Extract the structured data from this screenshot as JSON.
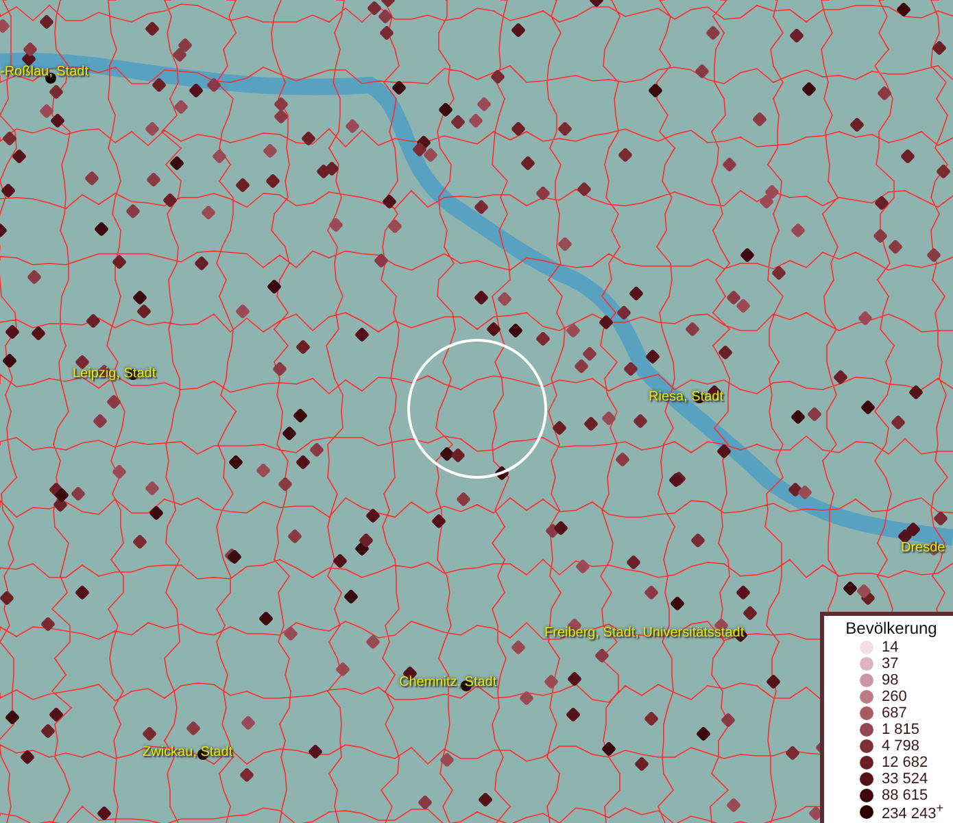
{
  "map": {
    "places": [
      {
        "name": "-Roßlau, Stadt"
      },
      {
        "name": "Leipzig, Stadt"
      },
      {
        "name": "Riesa, Stadt"
      },
      {
        "name": "Dresde"
      },
      {
        "name": "Freiberg, Stadt, Universitätsstadt"
      },
      {
        "name": "Chemnitz, Stadt"
      },
      {
        "name": "Zwickau, Stadt"
      }
    ]
  },
  "legend": {
    "title": "Bevölkerung",
    "entries": [
      {
        "label": "14",
        "color": "#f4dce8"
      },
      {
        "label": "37",
        "color": "#e0b4c2"
      },
      {
        "label": "98",
        "color": "#cd98a5"
      },
      {
        "label": "260",
        "color": "#bb7b86"
      },
      {
        "label": "687",
        "color": "#a85b64"
      },
      {
        "label": "1 815",
        "color": "#954550"
      },
      {
        "label": "4 798",
        "color": "#80323b"
      },
      {
        "label": "12 682",
        "color": "#6b2028"
      },
      {
        "label": "33 524",
        "color": "#55121a"
      },
      {
        "label": "88 615",
        "color": "#40080e"
      },
      {
        "label": "234 243$^{+}$",
        "color": "#2a0306"
      }
    ]
  }
}
